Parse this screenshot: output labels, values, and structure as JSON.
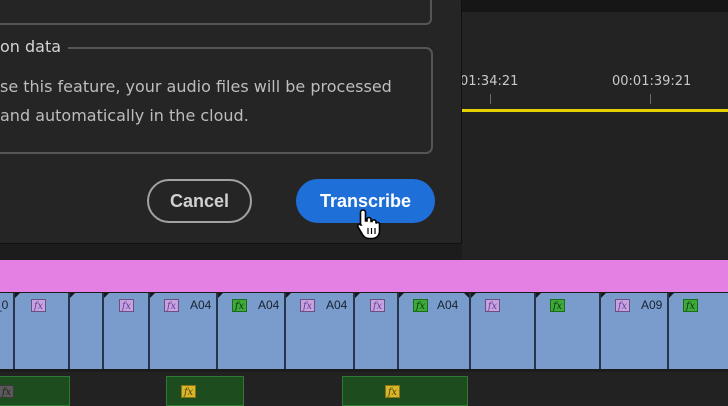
{
  "dialog": {
    "section_legend": "on data",
    "description": "se this feature, your audio files will be processed and automatically in the cloud.",
    "cancel_label": "Cancel",
    "transcribe_label": "Transcribe"
  },
  "monitor": {
    "timecodes": [
      "01:34:21",
      "00:01:39:21"
    ]
  },
  "timeline": {
    "video_clips": [
      {
        "label": "_0",
        "fx": "fx",
        "fx_color": "purple"
      },
      {
        "label": "",
        "fx": "",
        "fx_color": ""
      },
      {
        "label": "",
        "fx": "fx",
        "fx_color": "purple"
      },
      {
        "label": "A04",
        "fx": "fx",
        "fx_color": "purple"
      },
      {
        "label": "A04",
        "fx": "fx",
        "fx_color": "green"
      },
      {
        "label": "A04",
        "fx": "fx",
        "fx_color": "purple"
      },
      {
        "label": "",
        "fx": "fx",
        "fx_color": "purple"
      },
      {
        "label": "A04",
        "fx": "fx",
        "fx_color": "green"
      },
      {
        "label": "",
        "fx": "fx",
        "fx_color": "purple"
      },
      {
        "label": "",
        "fx": "fx",
        "fx_color": "green"
      },
      {
        "label": "A09",
        "fx": "fx",
        "fx_color": "purple"
      },
      {
        "label": "",
        "fx": "fx",
        "fx_color": "green"
      }
    ],
    "audio_clips": [
      {
        "fx": "fx",
        "fx_color": "gray"
      },
      {
        "fx": "fx",
        "fx_color": "yellow"
      },
      {
        "fx": "fx",
        "fx_color": "yellow"
      }
    ]
  },
  "colors": {
    "primary_button": "#1f6fd8",
    "marker_track": "#e47fe3",
    "video_clip": "#7a9ccc",
    "work_area_bar": "#e4d200"
  }
}
